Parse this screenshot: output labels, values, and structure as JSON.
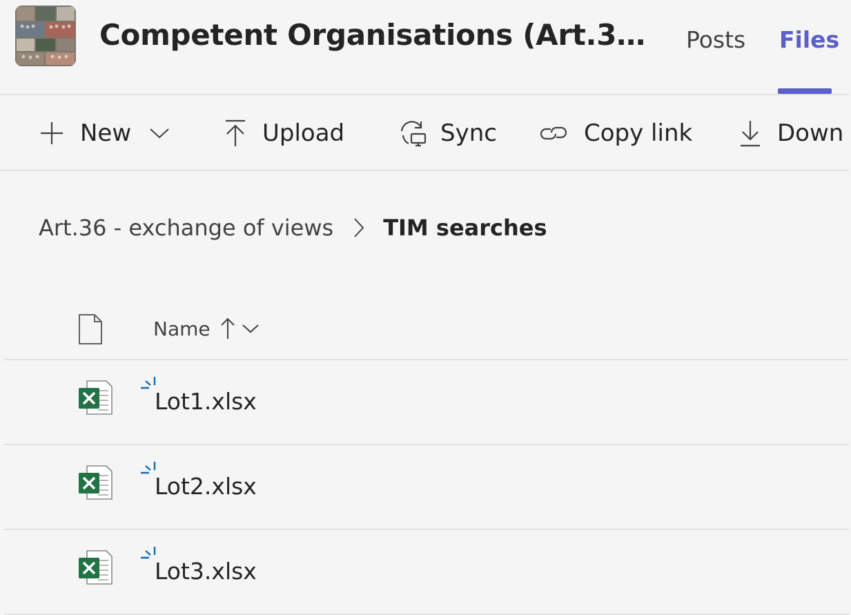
{
  "header": {
    "team_title": "Competent Organisations (Art.3…",
    "avatar_icon": "team-photo-collage",
    "tabs": [
      {
        "label": "Posts",
        "active": false
      },
      {
        "label": "Files",
        "active": true
      }
    ],
    "accent_color": "#5b5fc7"
  },
  "toolbar": {
    "new_label": "New",
    "upload_label": "Upload",
    "sync_label": "Sync",
    "copy_link_label": "Copy link",
    "download_label": "Down"
  },
  "breadcrumb": {
    "parent": "Art.36 - exchange of views",
    "current": "TIM searches"
  },
  "list": {
    "name_column": "Name",
    "sort_direction": "ascending",
    "files": [
      {
        "name": "Lot1.xlsx",
        "type_icon": "excel-file-icon",
        "new": true
      },
      {
        "name": "Lot2.xlsx",
        "type_icon": "excel-file-icon",
        "new": true
      },
      {
        "name": "Lot3.xlsx",
        "type_icon": "excel-file-icon",
        "new": true
      }
    ],
    "excel_color": "#217346",
    "new_marker_color": "#0f6cbd"
  }
}
